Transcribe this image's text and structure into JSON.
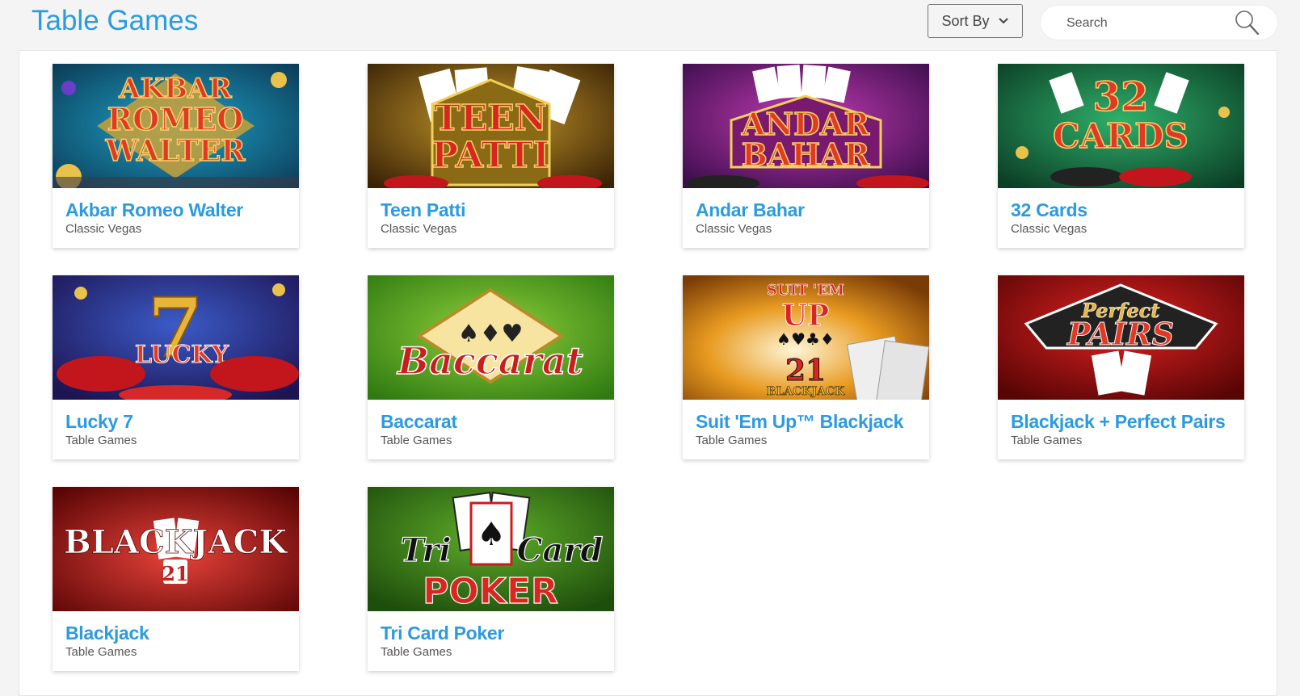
{
  "header": {
    "title": "Table Games",
    "sort_label": "Sort By",
    "search_placeholder": "Search"
  },
  "games": [
    {
      "title": "Akbar Romeo Walter",
      "category": "Classic Vegas",
      "art": [
        "AKBAR",
        "ROMEO",
        "WALTER"
      ]
    },
    {
      "title": "Teen Patti",
      "category": "Classic Vegas",
      "art": [
        "TEEN",
        "PATTI"
      ]
    },
    {
      "title": "Andar Bahar",
      "category": "Classic Vegas",
      "art": [
        "ANDAR",
        "BAHAR"
      ]
    },
    {
      "title": "32 Cards",
      "category": "Classic Vegas",
      "art": [
        "32",
        "CARDS"
      ]
    },
    {
      "title": "Lucky 7",
      "category": "Table Games",
      "art": [
        "7",
        "LUCKY"
      ]
    },
    {
      "title": "Baccarat",
      "category": "Table Games",
      "art": [
        "Baccarat"
      ]
    },
    {
      "title": "Suit 'Em Up™ Blackjack",
      "category": "Table Games",
      "art": [
        "SUIT 'EM",
        "UP",
        "21",
        "BLACKJACK"
      ]
    },
    {
      "title": "Blackjack + Perfect Pairs",
      "category": "Table Games",
      "art": [
        "Perfect",
        "PAIRS"
      ]
    },
    {
      "title": "Blackjack",
      "category": "Table Games",
      "art": [
        "BLACKJACK",
        "21"
      ]
    },
    {
      "title": "Tri Card Poker",
      "category": "Table Games",
      "art": [
        "Tri",
        "Card",
        "POKER"
      ]
    }
  ],
  "colors": {
    "accent": "#2b9be0",
    "page_bg": "#f4f4f4",
    "card_bg": "#ffffff"
  }
}
